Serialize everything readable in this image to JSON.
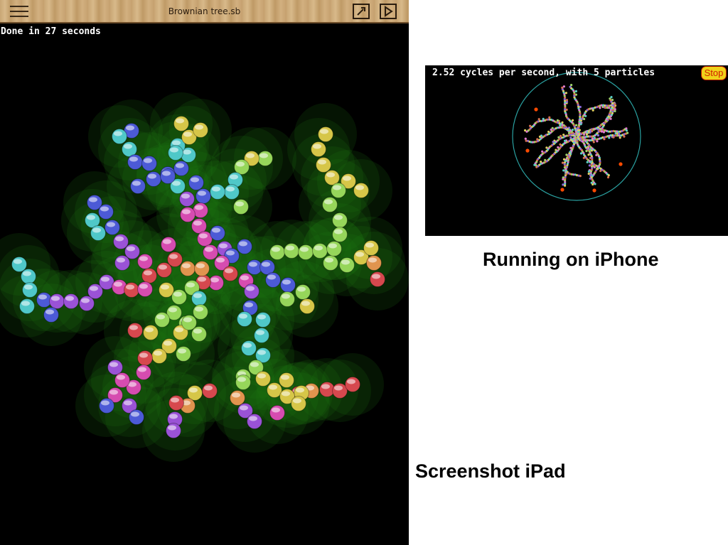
{
  "ipad": {
    "window_title": "Brownian tree.sb",
    "status_text": "Done in 27 seconds",
    "icons": {
      "menu": "hamburger-menu-icon",
      "edit": "edit-icon",
      "run": "play-icon"
    }
  },
  "iphone": {
    "status_text": "2.52 cycles per second, with 5 particles",
    "stop_label": "Stop"
  },
  "captions": {
    "iphone": "Running on iPhone",
    "ipad": "Screenshot iPad"
  },
  "colors": {
    "glow": "#1f7a12",
    "cyan": "#4fc8c8",
    "blue": "#4c5ad6",
    "purple": "#9a52d6",
    "magenta": "#d64cb0",
    "red": "#d6484e",
    "orange": "#e0944e",
    "yellow": "#d6c648",
    "green": "#96d65a",
    "particle": "#ff4a00",
    "stop_bg": "#f0d21a"
  }
}
